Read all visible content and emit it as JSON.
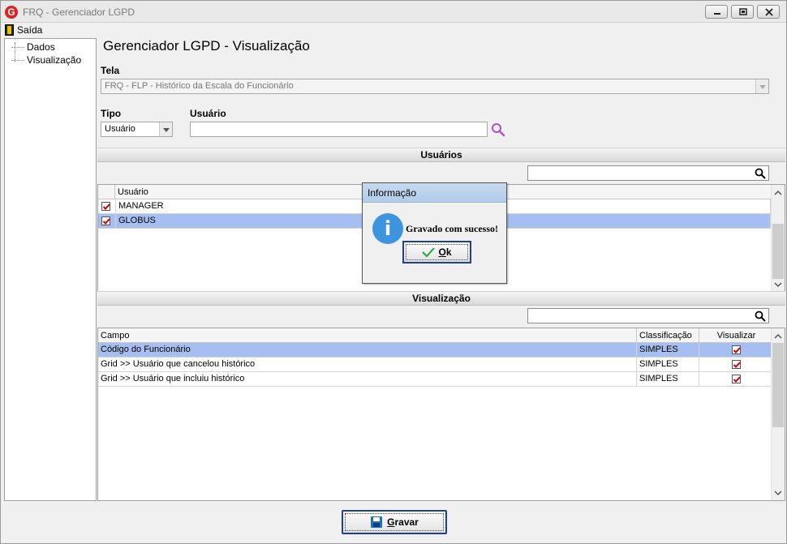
{
  "window": {
    "title": "FRQ - Gerenciador LGPD"
  },
  "menu": {
    "exit_label": "Saída"
  },
  "tree": {
    "items": [
      "Dados",
      "Visualização"
    ]
  },
  "main": {
    "title": "Gerenciador LGPD - Visualização",
    "tela_label": "Tela",
    "tela_value": "FRQ - FLP - Histórico da Escala do Funcionário",
    "tipo_label": "Tipo",
    "tipo_value": "Usuário",
    "usuario_label": "Usuário",
    "usuario_value": ""
  },
  "users_section": {
    "title": "Usuários",
    "search_value": "",
    "column_header": "Usuário",
    "rows": [
      {
        "name": "MANAGER",
        "checked": true,
        "selected": false
      },
      {
        "name": "GLOBUS",
        "checked": true,
        "selected": true
      }
    ]
  },
  "view_section": {
    "title": "Visualização",
    "search_value": "",
    "columns": [
      "Campo",
      "Classificação",
      "Visualizar"
    ],
    "rows": [
      {
        "campo": "Código do Funcionário",
        "classificacao": "SIMPLES",
        "visualizar": true,
        "selected": true
      },
      {
        "campo": "Grid >> Usuário que cancelou histórico",
        "classificacao": "SIMPLES",
        "visualizar": true,
        "selected": false
      },
      {
        "campo": "Grid >> Usuário que incluiu histórico",
        "classificacao": "SIMPLES",
        "visualizar": true,
        "selected": false
      }
    ]
  },
  "save_button": {
    "label": "Gravar"
  },
  "dialog": {
    "title": "Informação",
    "message": "Gravado com sucesso!",
    "ok_label": "Ok",
    "icon": "info-icon"
  },
  "colors": {
    "selection": "#a7bff0",
    "check": "#d00000",
    "info": "#3d95e0",
    "search_accent": "#b050c0"
  }
}
